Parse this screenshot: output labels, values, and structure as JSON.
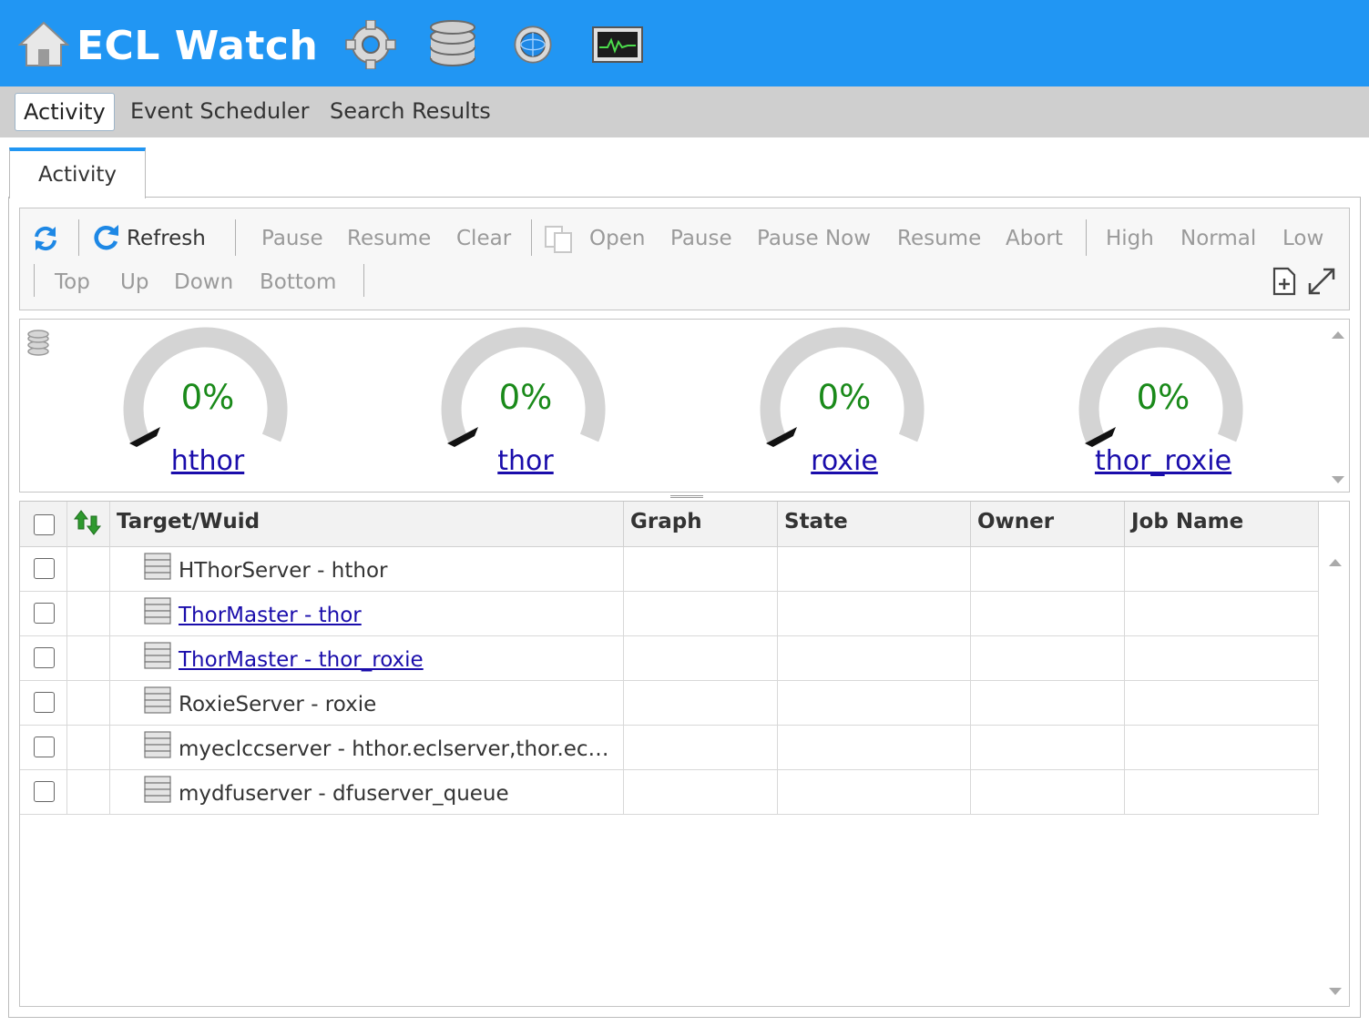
{
  "header": {
    "title": "ECL Watch",
    "icons": [
      "home-icon",
      "gear-icon",
      "database-icon",
      "globe-icon",
      "monitor-icon"
    ]
  },
  "top_tabs": [
    {
      "label": "Activity",
      "active": true
    },
    {
      "label": "Event Scheduler",
      "active": false
    },
    {
      "label": "Search Results",
      "active": false
    }
  ],
  "inner_tab": {
    "label": "Activity"
  },
  "toolbar": {
    "refresh": "Refresh",
    "pause": "Pause",
    "resume": "Resume",
    "clear": "Clear",
    "open": "Open",
    "pause2": "Pause",
    "pause_now": "Pause Now",
    "resume2": "Resume",
    "abort": "Abort",
    "high": "High",
    "normal": "Normal",
    "low": "Low",
    "top": "Top",
    "up": "Up",
    "down": "Down",
    "bottom": "Bottom"
  },
  "gauges": [
    {
      "percent": "0%",
      "value": 0,
      "name": "hthor"
    },
    {
      "percent": "0%",
      "value": 0,
      "name": "thor"
    },
    {
      "percent": "0%",
      "value": 0,
      "name": "roxie"
    },
    {
      "percent": "0%",
      "value": 0,
      "name": "thor_roxie"
    }
  ],
  "grid": {
    "columns": [
      "Target/Wuid",
      "Graph",
      "State",
      "Owner",
      "Job Name"
    ],
    "rows": [
      {
        "target": "HThorServer - hthor",
        "link": false
      },
      {
        "target": "ThorMaster - thor",
        "link": true
      },
      {
        "target": "ThorMaster - thor_roxie",
        "link": true
      },
      {
        "target": "RoxieServer - roxie",
        "link": false
      },
      {
        "target": "myeclccserver - hthor.eclserver,thor.ec…",
        "link": false
      },
      {
        "target": "mydfuserver - dfuserver_queue",
        "link": false
      }
    ]
  },
  "colors": {
    "header_bg": "#2196f3",
    "gauge_text": "#1a8a1a",
    "link": "#1a0dab"
  }
}
